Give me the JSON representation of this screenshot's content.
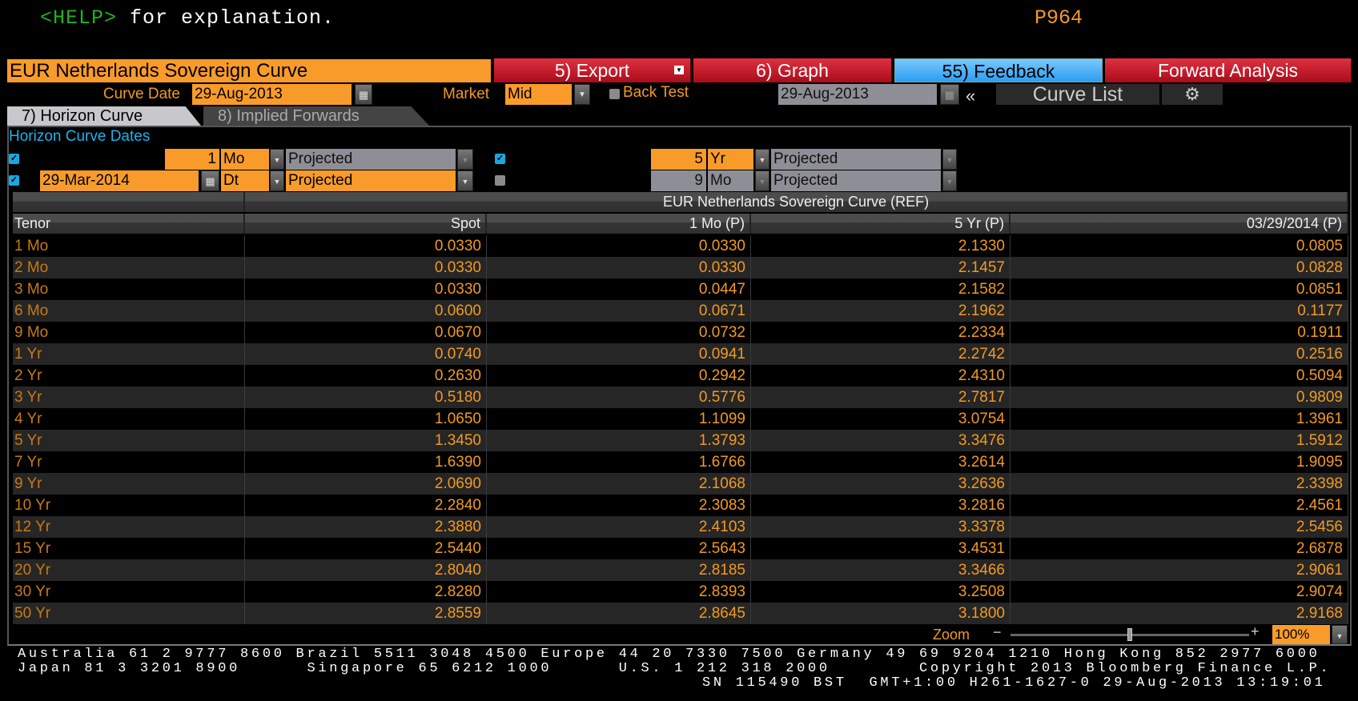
{
  "command_line": {
    "help_key": "<HELP>",
    "help_text": " for explanation.",
    "page_code": "P964"
  },
  "header": {
    "title": "EUR Netherlands Sovereign Curve",
    "export": "5) Export",
    "graph": "6) Graph",
    "feedback": "55) Feedback",
    "forward_analysis": "Forward Analysis"
  },
  "controls": {
    "curve_date_label": "Curve Date",
    "curve_date": "29-Aug-2013",
    "market_label": "Market",
    "market": "Mid",
    "back_test_label": "Back Test",
    "back_test_checked": false,
    "back_test_date": "29-Aug-2013",
    "collapse": "«",
    "curve_list": "Curve List"
  },
  "tabs": [
    {
      "label": "7) Horizon Curve",
      "active": true
    },
    {
      "label": "8) Implied Forwards",
      "active": false
    }
  ],
  "horizon": {
    "title": "Horizon Curve Dates",
    "rows": [
      {
        "checked": true,
        "date": "",
        "num": "1",
        "unit": "Mo",
        "mode": "Projected"
      },
      {
        "checked": true,
        "date": "29-Mar-2014",
        "num": "",
        "unit": "Dt",
        "mode": "Projected"
      },
      {
        "checked": true,
        "num": "5",
        "unit": "Yr",
        "mode": "Projected"
      },
      {
        "checked": false,
        "num": "9",
        "unit": "Mo",
        "mode": "Projected"
      }
    ]
  },
  "table": {
    "group_header": "EUR Netherlands Sovereign Curve (REF)",
    "columns": [
      "Tenor",
      "Spot",
      "1 Mo (P)",
      "5 Yr (P)",
      "03/29/2014 (P)"
    ],
    "rows": [
      [
        "1 Mo",
        "0.0330",
        "0.0330",
        "2.1330",
        "0.0805"
      ],
      [
        "2 Mo",
        "0.0330",
        "0.0330",
        "2.1457",
        "0.0828"
      ],
      [
        "3 Mo",
        "0.0330",
        "0.0447",
        "2.1582",
        "0.0851"
      ],
      [
        "6 Mo",
        "0.0600",
        "0.0671",
        "2.1962",
        "0.1177"
      ],
      [
        "9 Mo",
        "0.0670",
        "0.0732",
        "2.2334",
        "0.1911"
      ],
      [
        "1 Yr",
        "0.0740",
        "0.0941",
        "2.2742",
        "0.2516"
      ],
      [
        "2 Yr",
        "0.2630",
        "0.2942",
        "2.4310",
        "0.5094"
      ],
      [
        "3 Yr",
        "0.5180",
        "0.5776",
        "2.7817",
        "0.9809"
      ],
      [
        "4 Yr",
        "1.0650",
        "1.1099",
        "3.0754",
        "1.3961"
      ],
      [
        "5 Yr",
        "1.3450",
        "1.3793",
        "3.3476",
        "1.5912"
      ],
      [
        "7 Yr",
        "1.6390",
        "1.6766",
        "3.2614",
        "1.9095"
      ],
      [
        "9 Yr",
        "2.0690",
        "2.1068",
        "3.2636",
        "2.3398"
      ],
      [
        "10 Yr",
        "2.2840",
        "2.3083",
        "3.2816",
        "2.4561"
      ],
      [
        "12 Yr",
        "2.3880",
        "2.4103",
        "3.3378",
        "2.5456"
      ],
      [
        "15 Yr",
        "2.5440",
        "2.5643",
        "3.4531",
        "2.6878"
      ],
      [
        "20 Yr",
        "2.8040",
        "2.8185",
        "3.3466",
        "2.9061"
      ],
      [
        "30 Yr",
        "2.8280",
        "2.8393",
        "3.2508",
        "2.9074"
      ],
      [
        "50 Yr",
        "2.8559",
        "2.8645",
        "3.1800",
        "2.9168"
      ]
    ]
  },
  "zoom": {
    "label": "Zoom",
    "minus": "−",
    "plus": "+",
    "value": "100%",
    "slider_fraction": 0.5
  },
  "footer": {
    "line1": "Australia 61 2 9777 8600 Brazil 5511 3048 4500 Europe 44 20 7330 7500 Germany 49 69 9204 1210 Hong Kong 852 2977 6000",
    "line2": "Japan 81 3 3201 8900      Singapore 65 6212 1000      U.S. 1 212 318 2000        Copyright 2013 Bloomberg Finance L.P.",
    "line3": "SN 115490 BST  GMT+1:00 H261-1627-0 29-Aug-2013 13:19:01"
  }
}
